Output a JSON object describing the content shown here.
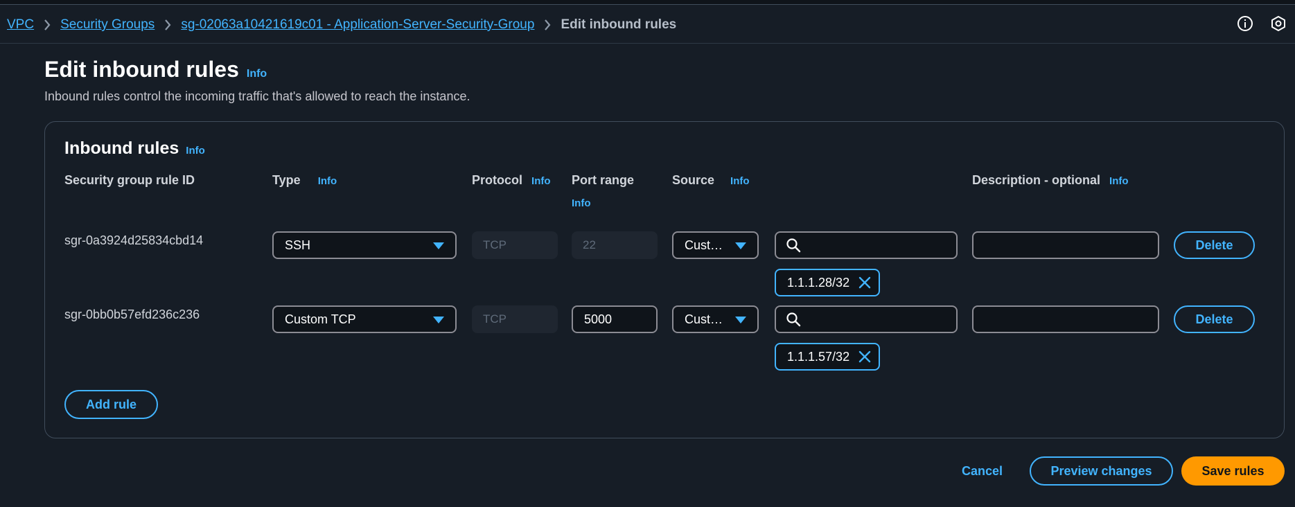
{
  "breadcrumb": {
    "items": [
      "VPC",
      "Security Groups",
      "sg-02063a10421619c01 - Application-Server-Security-Group"
    ],
    "current": "Edit inbound rules"
  },
  "page": {
    "title": "Edit inbound rules",
    "title_info": "Info",
    "description": "Inbound rules control the incoming traffic that's allowed to reach the instance."
  },
  "panel": {
    "title": "Inbound rules",
    "title_info": "Info",
    "columns": {
      "rule_id": "Security group rule ID",
      "type": "Type",
      "protocol": "Protocol",
      "port_range": "Port range",
      "source": "Source",
      "description": "Description - optional",
      "info": "Info"
    },
    "rows": [
      {
        "rule_id": "sgr-0a3924d25834cbd14",
        "type": "SSH",
        "protocol": "TCP",
        "port_range": "22",
        "source_type": "Cust…",
        "source_search": "",
        "source_token": "1.1.1.28/32",
        "description": "",
        "delete_label": "Delete"
      },
      {
        "rule_id": "sgr-0bb0b57efd236c236",
        "type": "Custom TCP",
        "protocol": "TCP",
        "port_range": "5000",
        "source_type": "Cust…",
        "source_search": "",
        "source_token": "1.1.1.57/32",
        "description": "",
        "delete_label": "Delete"
      }
    ],
    "add_rule_label": "Add rule"
  },
  "footer": {
    "cancel_label": "Cancel",
    "preview_label": "Preview changes",
    "save_label": "Save rules"
  },
  "colors": {
    "background": "#161d26",
    "link": "#42b4ff",
    "primary": "#ff9900"
  }
}
